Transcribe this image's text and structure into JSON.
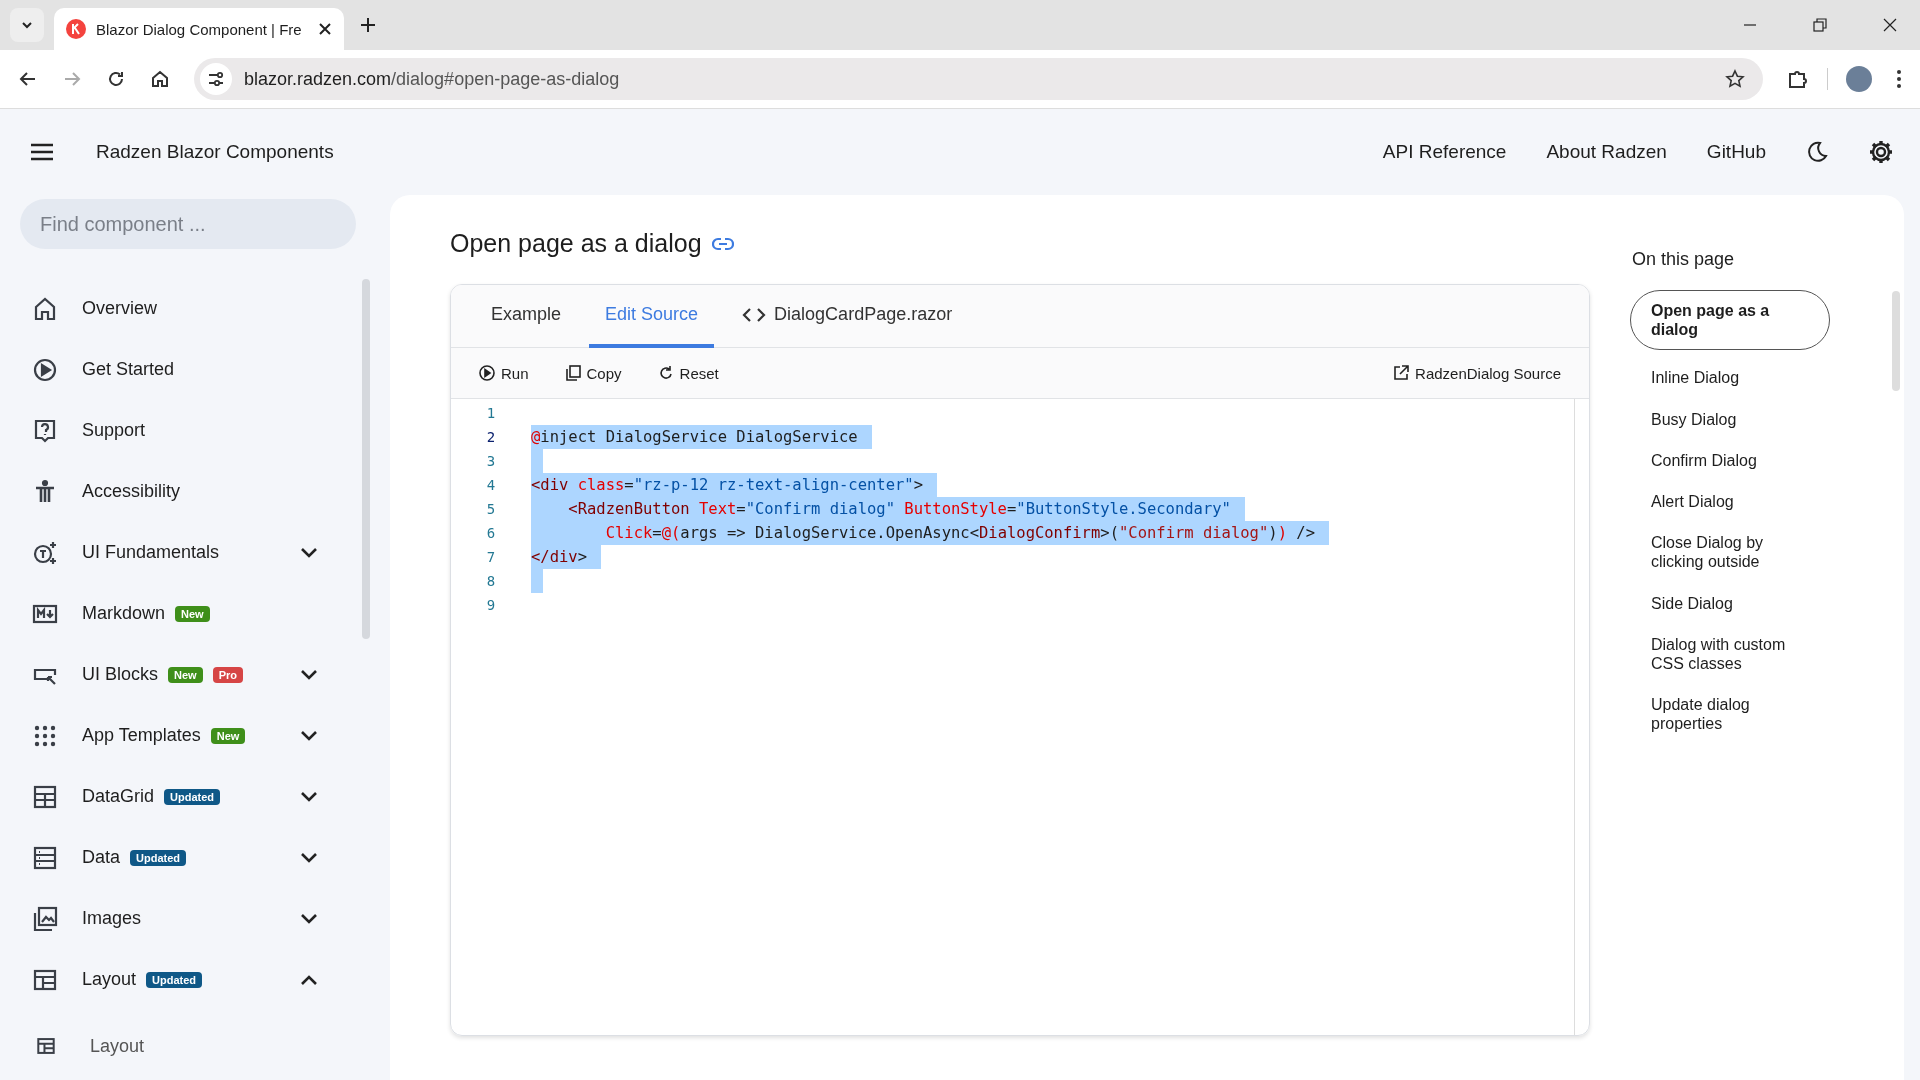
{
  "browser": {
    "tab_title": "Blazor Dialog Component | Fre",
    "url_host": "blazor.radzen.com",
    "url_path": "/dialog#open-page-as-dialog"
  },
  "header": {
    "title": "Radzen Blazor Components",
    "links": [
      "API Reference",
      "About Radzen",
      "GitHub"
    ]
  },
  "search": {
    "placeholder": "Find component ..."
  },
  "sidebar": {
    "items": [
      {
        "label": "Overview"
      },
      {
        "label": "Get Started"
      },
      {
        "label": "Support"
      },
      {
        "label": "Accessibility"
      },
      {
        "label": "UI Fundamentals",
        "expanded": false
      },
      {
        "label": "Markdown",
        "badges": [
          {
            "text": "New",
            "color": "#3f8f1a"
          }
        ]
      },
      {
        "label": "UI Blocks",
        "badges": [
          {
            "text": "New",
            "color": "#3f8f1a"
          },
          {
            "text": "Pro",
            "color": "#d64545"
          }
        ],
        "expanded": false
      },
      {
        "label": "App Templates",
        "badges": [
          {
            "text": "New",
            "color": "#3f8f1a"
          }
        ],
        "expanded": false
      },
      {
        "label": "DataGrid",
        "badges": [
          {
            "text": "Updated",
            "color": "#0f5887"
          }
        ],
        "expanded": false
      },
      {
        "label": "Data",
        "badges": [
          {
            "text": "Updated",
            "color": "#0f5887"
          }
        ],
        "expanded": false
      },
      {
        "label": "Images",
        "expanded": false
      },
      {
        "label": "Layout",
        "badges": [
          {
            "text": "Updated",
            "color": "#0f5887"
          }
        ],
        "expanded": true,
        "children": [
          {
            "label": "Layout"
          }
        ]
      }
    ]
  },
  "page": {
    "title": "Open page as a dialog"
  },
  "tabs": [
    {
      "label": "Example",
      "selected": false
    },
    {
      "label": "Edit Source",
      "selected": true
    },
    {
      "label": "DialogCardPage.razor",
      "selected": false,
      "kind": "file"
    }
  ],
  "toolbar": {
    "buttons": [
      "Run",
      "Copy",
      "Reset"
    ],
    "source_link": "RadzenDialog Source"
  },
  "code": {
    "lines": [
      {
        "number": "1",
        "selected": false
      },
      {
        "number": "2",
        "selected": true,
        "tokens": [
          {
            "text": "@",
            "color": "#e00000"
          },
          {
            "text": "inject DialogService DialogService",
            "color": "#1e1e1e"
          }
        ]
      },
      {
        "number": "3",
        "selected": true
      },
      {
        "number": "4",
        "selected": true,
        "tokens": [
          {
            "text": "<div",
            "color": "#800000"
          },
          {
            "text": " class",
            "color": "#e50000"
          },
          {
            "text": "=",
            "color": "#1e1e1e"
          },
          {
            "text": "\"rz-p-12 rz-text-align-center\"",
            "color": "#0451a5"
          },
          {
            "text": ">",
            "color": "#1e1e1e"
          }
        ]
      },
      {
        "number": "5",
        "selected": true,
        "tokens": [
          {
            "text": "    <RadzenButton",
            "color": "#800000"
          },
          {
            "text": " Text",
            "color": "#e50000"
          },
          {
            "text": "=",
            "color": "#1e1e1e"
          },
          {
            "text": "\"Confirm dialog\"",
            "color": "#0451a5"
          },
          {
            "text": " ButtonStyle",
            "color": "#e50000"
          },
          {
            "text": "=",
            "color": "#1e1e1e"
          },
          {
            "text": "\"ButtonStyle.Secondary\"",
            "color": "#0451a5"
          }
        ]
      },
      {
        "number": "6",
        "selected": true,
        "tokens": [
          {
            "text": "        Click",
            "color": "#e50000"
          },
          {
            "text": "=",
            "color": "#1e1e1e"
          },
          {
            "text": "@(",
            "color": "#e00000"
          },
          {
            "text": "args => DialogService.OpenAsync<",
            "color": "#1e1e1e"
          },
          {
            "text": "DialogConfirm",
            "color": "#800000"
          },
          {
            "text": ">(",
            "color": "#1e1e1e"
          },
          {
            "text": "\"Confirm dialog\"",
            "color": "#a31515"
          },
          {
            "text": ")",
            "color": "#1e1e1e"
          },
          {
            "text": ")",
            "color": "#e00000"
          },
          {
            "text": " />",
            "color": "#1e1e1e"
          }
        ]
      },
      {
        "number": "7",
        "selected": true,
        "tokens": [
          {
            "text": "</div",
            "color": "#800000"
          },
          {
            "text": ">",
            "color": "#1e1e1e"
          }
        ]
      },
      {
        "number": "8",
        "selected": true
      },
      {
        "number": "9",
        "selected": false
      }
    ]
  },
  "toc": {
    "title": "On this page",
    "items": [
      {
        "label": "Open page as a dialog",
        "selected": true
      },
      {
        "label": "Inline Dialog",
        "selected": false
      },
      {
        "label": "Busy Dialog",
        "selected": false
      },
      {
        "label": "Confirm Dialog",
        "selected": false
      },
      {
        "label": "Alert Dialog",
        "selected": false
      },
      {
        "label": "Close Dialog by clicking outside",
        "selected": false
      },
      {
        "label": "Side Dialog",
        "selected": false
      },
      {
        "label": "Dialog with custom CSS classes",
        "selected": false
      },
      {
        "label": "Update dialog properties",
        "selected": false
      }
    ]
  }
}
